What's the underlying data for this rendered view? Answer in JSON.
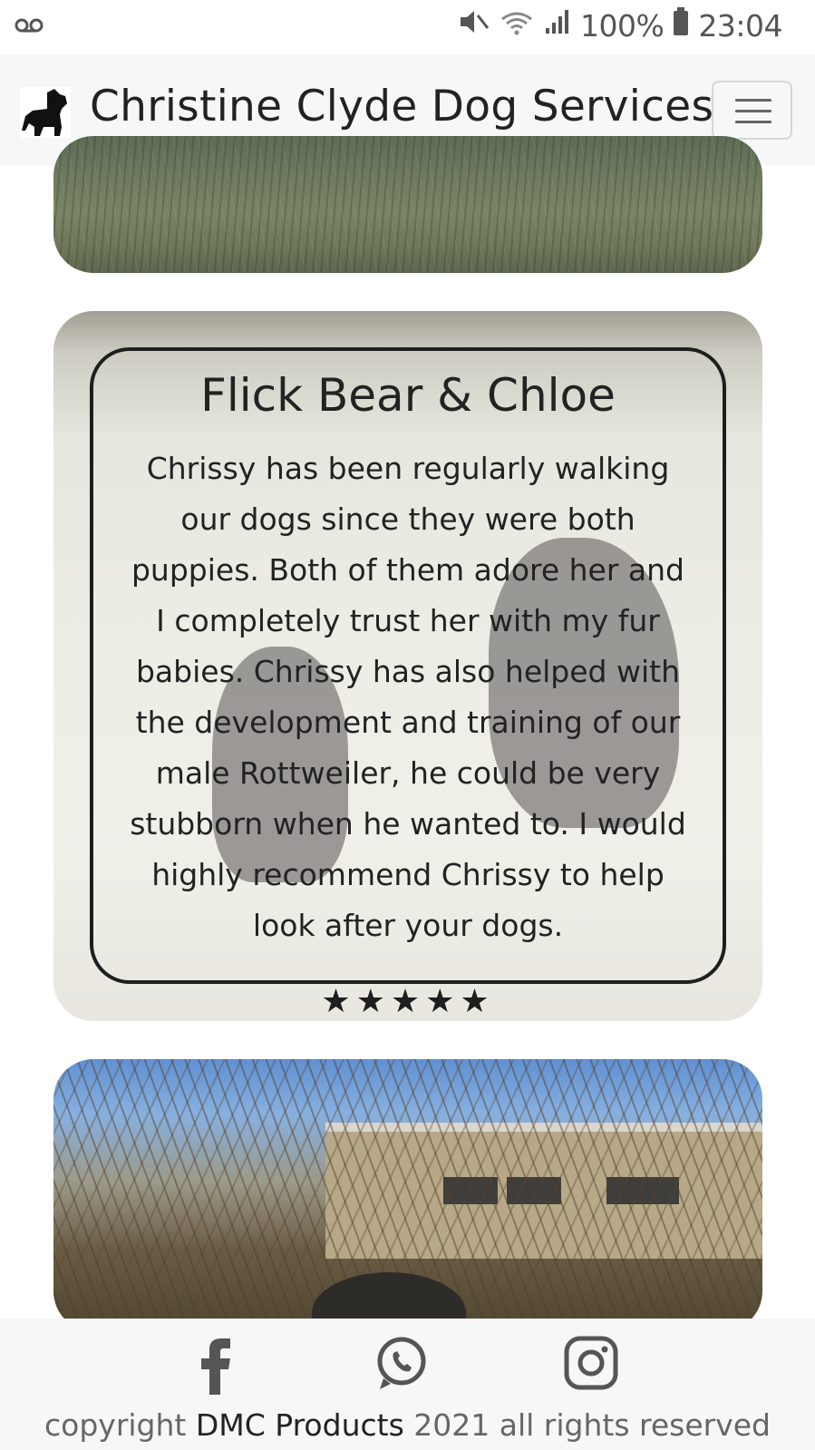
{
  "status": {
    "battery": "100%",
    "time": "23:04"
  },
  "navbar": {
    "brand": "Christine Clyde Dog Services"
  },
  "review": {
    "title": "Flick Bear & Chloe",
    "text": "Chrissy has been regularly walking our dogs since they were both puppies. Both of them adore her and I completely trust her with my fur babies. Chrissy has also helped with the development and training of our male Rottweiler, he could be very stubborn when he wanted to. I would highly recommend Chrissy to help look after your dogs.",
    "rating": 5,
    "stars": "★★★★★"
  },
  "footer": {
    "copyright_prefix": "copyright ",
    "company": "DMC Products",
    "copyright_suffix": " 2021 all rights reserved",
    "social": [
      "facebook-icon",
      "whatsapp-icon",
      "instagram-icon"
    ]
  }
}
